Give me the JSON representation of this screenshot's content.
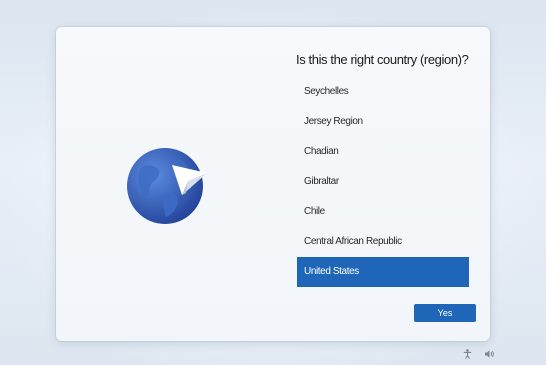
{
  "setup": {
    "title": "Is this the right country (region)?",
    "countries": [
      {
        "label": "Seychelles",
        "selected": false
      },
      {
        "label": "Jersey Region",
        "selected": false
      },
      {
        "label": "Chadian",
        "selected": false
      },
      {
        "label": "Gibraltar",
        "selected": false
      },
      {
        "label": "Chile",
        "selected": false
      },
      {
        "label": "Central African Republic",
        "selected": false
      },
      {
        "label": "United States",
        "selected": true
      }
    ],
    "yes_label": "Yes"
  },
  "tray": {
    "icons": [
      "accessibility-icon",
      "volume-icon"
    ]
  },
  "colors": {
    "accent": "#1f66b8",
    "globe_dark": "#2a52a8",
    "globe_light": "#4f7fd6"
  }
}
